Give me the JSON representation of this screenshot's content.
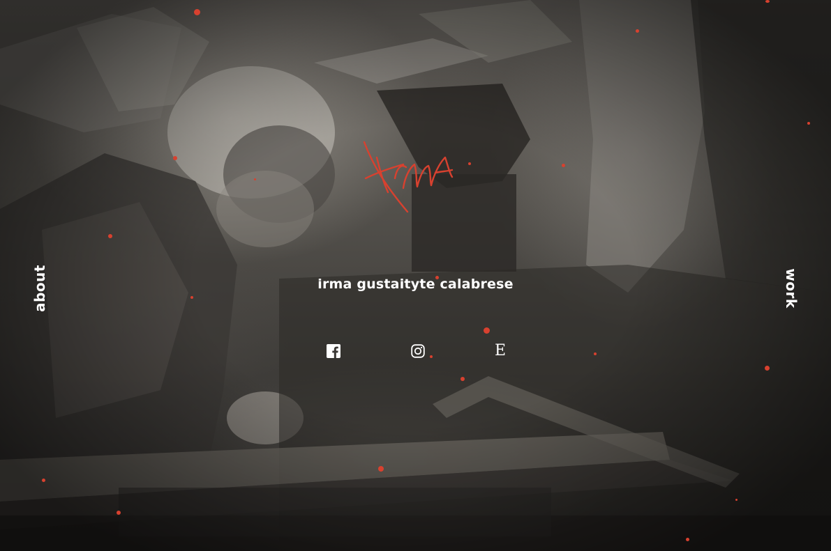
{
  "site": {
    "signature_text": "Irma",
    "name": "irma gustaityte calabrese",
    "accent_color": "#d8412f"
  },
  "nav": {
    "about_label": "about",
    "work_label": "work"
  },
  "social": [
    {
      "name": "facebook",
      "icon": "facebook-icon"
    },
    {
      "name": "instagram",
      "icon": "instagram-icon"
    },
    {
      "name": "etsy",
      "icon": "etsy-icon",
      "glyph": "E"
    }
  ]
}
